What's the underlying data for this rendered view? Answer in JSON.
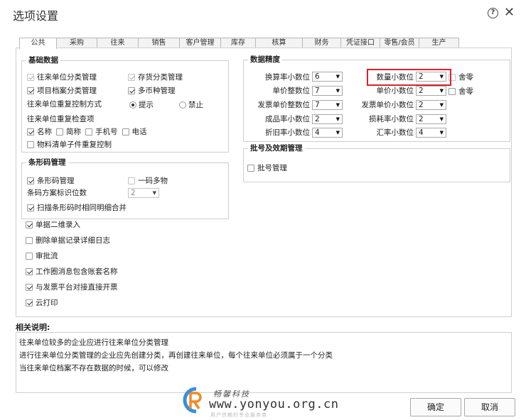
{
  "window": {
    "title": "选项设置",
    "help_icon": "question-circle-icon",
    "close_icon": "close-icon"
  },
  "tabs": [
    {
      "label": "公共",
      "active": true
    },
    {
      "label": "采购"
    },
    {
      "label": "往来"
    },
    {
      "label": "销售"
    },
    {
      "label": "客户管理"
    },
    {
      "label": "库存"
    },
    {
      "label": "核算"
    },
    {
      "label": "财务"
    },
    {
      "label": "凭证接口"
    },
    {
      "label": "零售/会员"
    },
    {
      "label": "生产"
    }
  ],
  "basic_data": {
    "title": "基础数据",
    "partner_category": {
      "label": "往来单位分类管理",
      "checked": true,
      "disabled": true
    },
    "inventory_category": {
      "label": "存货分类管理",
      "checked": true,
      "disabled": true
    },
    "project_category": {
      "label": "项目档案分类管理",
      "checked": true
    },
    "multi_currency": {
      "label": "多币种管理",
      "checked": true
    },
    "dup_control_label": "往来单位重复控制方式",
    "dup_prompt": {
      "label": "提示",
      "checked": true
    },
    "dup_forbid": {
      "label": "禁止",
      "checked": false
    },
    "dup_check_label": "往来单位重复检查项",
    "check_name": {
      "label": "名称",
      "checked": true
    },
    "check_abbr": {
      "label": "简称",
      "checked": false
    },
    "check_phone": {
      "label": "手机号",
      "checked": false
    },
    "check_tel": {
      "label": "电话",
      "checked": false
    },
    "bom_dup": {
      "label": "物料清单子件重复控制",
      "checked": false
    }
  },
  "barcode": {
    "title": "条形码管理",
    "manage": {
      "label": "条形码管理",
      "checked": true
    },
    "one_code_multi": {
      "label": "一码多物",
      "checked": false
    },
    "scheme_label": "条码方案标识位数",
    "scheme_value": "2",
    "merge_detail": {
      "label": "扫描条形码时相同明细合并",
      "checked": true
    }
  },
  "misc": [
    {
      "label": "单据二维录入",
      "checked": true
    },
    {
      "label": "删除单据记录详细日志",
      "checked": false
    },
    {
      "label": "审批流",
      "checked": false
    },
    {
      "label": "工作圈消息包含账套名称",
      "checked": true
    },
    {
      "label": "与发票平台对接直接开票",
      "checked": true
    },
    {
      "label": "云打印",
      "checked": true
    }
  ],
  "precision": {
    "title": "数据精度",
    "left": [
      {
        "label": "换算率小数位",
        "value": "6"
      },
      {
        "label": "单价整数位",
        "value": "7"
      },
      {
        "label": "发票单价整数位",
        "value": "7"
      },
      {
        "label": "成品率小数位",
        "value": "2"
      },
      {
        "label": "折旧率小数位",
        "value": "4"
      }
    ],
    "right": [
      {
        "label": "数量小数位",
        "value": "2",
        "rounding": {
          "label": "舍零",
          "checked": false,
          "disabled": true
        }
      },
      {
        "label": "单价小数位",
        "value": "2",
        "rounding": {
          "label": "舍零",
          "checked": false
        }
      },
      {
        "label": "发票单价小数位",
        "value": "2"
      },
      {
        "label": "损耗率小数位",
        "value": "2"
      },
      {
        "label": "汇率小数位",
        "value": "4"
      }
    ]
  },
  "batch": {
    "title": "批号及效期管理",
    "manage": {
      "label": "批号管理",
      "checked": false
    }
  },
  "notes": {
    "title": "相关说明:",
    "lines": [
      "往来单位较多的企业应进行往来单位分类管理",
      "进行往来单位分类管理的企业应先创建分类，再创建往来单位，每个往来单位必须属于一个分类",
      "当往来单位档案不存在数据的时候，可以修改"
    ]
  },
  "buttons": {
    "ok": "确定",
    "cancel": "取消"
  },
  "watermark": {
    "cn": "畅馨科技",
    "url": "www.yonyou.org.cn",
    "small": "用户信赖的专业服务商"
  },
  "colors": {
    "highlight": "#d9232a",
    "logo_blue": "#3a8fd8",
    "logo_orange": "#f08a24"
  }
}
